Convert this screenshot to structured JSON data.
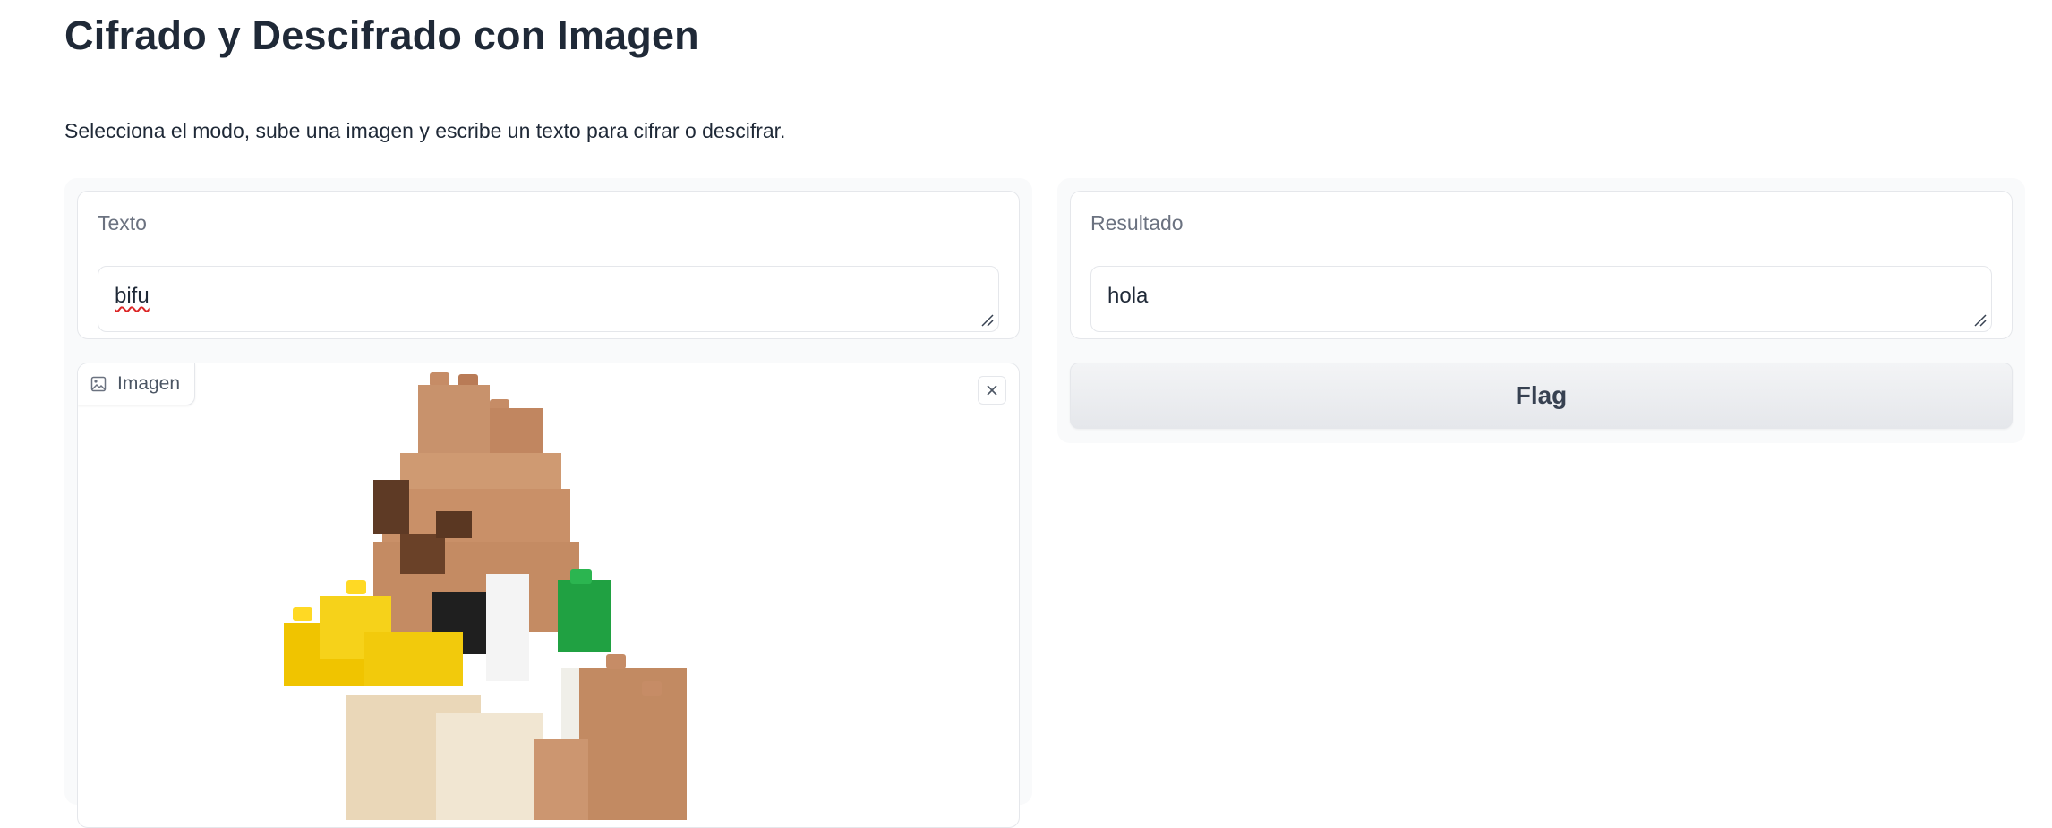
{
  "page": {
    "title": "Cifrado y Descifrado con Imagen",
    "description": "Selecciona el modo, sube una imagen y escribe un texto para cifrar o descifrar."
  },
  "input_panel": {
    "text_field": {
      "label": "Texto",
      "value": "bifu"
    },
    "image_field": {
      "label": "Imagen",
      "icon": "image-icon",
      "clear_icon": "close-icon"
    }
  },
  "output_panel": {
    "result_field": {
      "label": "Resultado",
      "value": "hola"
    },
    "flag_button": {
      "label": "Flag"
    }
  },
  "colors": {
    "panel_background": "#f9fafb",
    "border": "#e5e7eb",
    "label_text": "#6b7280",
    "title_text": "#1f2937"
  }
}
